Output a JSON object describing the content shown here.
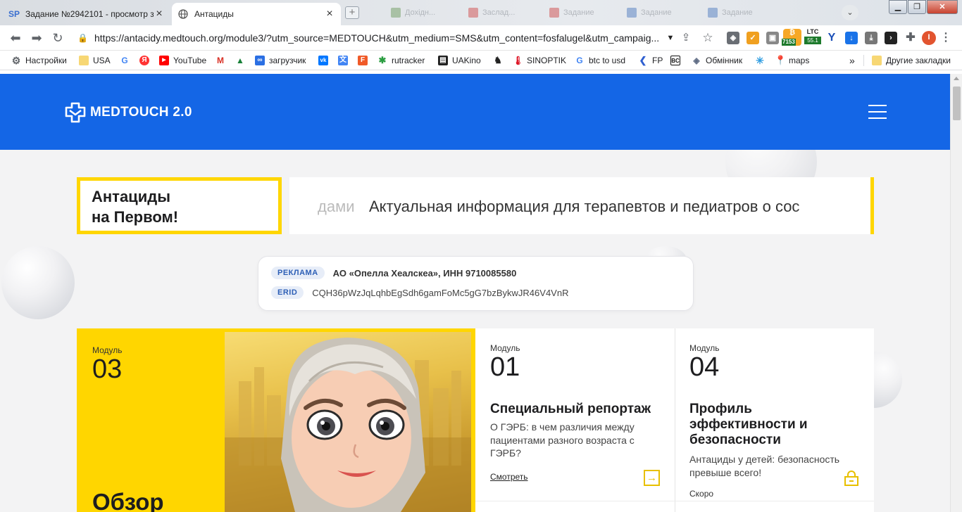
{
  "browser": {
    "tabs": [
      {
        "favicon": "SP",
        "title": "Задание №2942101 - просмотр з",
        "active": false
      },
      {
        "favicon": "globe-icon",
        "title": "Антациды",
        "active": true
      }
    ],
    "url": "https://antacidy.medtouch.org/module3/?utm_source=MEDTOUCH&utm_medium=SMS&utm_content=fosfalugel&utm_campaig...",
    "ext_ltc_label": "LTC",
    "ext_badge_1": "7153",
    "ext_badge_2": "55.1",
    "profile_initial": "I",
    "bookmarks": [
      {
        "label": "Настройки",
        "icon": "gear-icon"
      },
      {
        "label": "USA",
        "icon": "folder-icon"
      },
      {
        "label": "",
        "icon": "google-icon"
      },
      {
        "label": "",
        "icon": "yandex-icon"
      },
      {
        "label": "YouTube",
        "icon": "youtube-icon"
      },
      {
        "label": "",
        "icon": "gmail-icon"
      },
      {
        "label": "",
        "icon": "drive-icon"
      },
      {
        "label": "загрузчик",
        "icon": "infinity-icon"
      },
      {
        "label": "",
        "icon": "vk-icon"
      },
      {
        "label": "",
        "icon": "translate-icon"
      },
      {
        "label": "",
        "icon": "f-icon"
      },
      {
        "label": "rutracker",
        "icon": "rutracker-icon"
      },
      {
        "label": "UAKino",
        "icon": "uakino-icon"
      },
      {
        "label": "",
        "icon": "chess-icon"
      },
      {
        "label": "SINOPTIK",
        "icon": "thermometer-icon"
      },
      {
        "label": "btc to usd",
        "icon": "google-icon"
      },
      {
        "label": "FP",
        "icon": "fp-icon"
      },
      {
        "label": "",
        "icon": "bc-icon"
      },
      {
        "label": "Обмінник",
        "icon": "exchange-icon"
      },
      {
        "label": "",
        "icon": "pinwheel-icon"
      },
      {
        "label": "maps",
        "icon": "maps-icon"
      }
    ],
    "bookmarks_more": "»",
    "other_bookmarks": "Другие закладки"
  },
  "site": {
    "logo_text": "MEDTOUCH 2.0",
    "hero_title_line1": "Антациды",
    "hero_title_line2": "на Первом!",
    "ticker_faded": "дами",
    "ticker_text": "Актуальная информация для терапевтов и педиатров о сос",
    "ad": {
      "label1": "РЕКЛАМА",
      "value1": "АО «Опелла Хеалскеа», ИНН 9710085580",
      "label2": "ERID",
      "value2": "CQH36pWzJqLqhbEgSdh6gamFoMc5gG7bzBykwJR46V4VnR"
    },
    "modules": {
      "featured": {
        "label": "Модуль",
        "number": "03",
        "title": "Обзор"
      },
      "m01": {
        "label": "Модуль",
        "number": "01",
        "title": "Специальный репортаж",
        "desc": "О ГЭРБ: в чем различия между пациентами разного возраста с ГЭРБ?",
        "link": "Смотреть"
      },
      "m04": {
        "label": "Модуль",
        "number": "04",
        "title": "Профиль эффективности и безопасности",
        "desc": "Антациды у детей: безопасность превыше всего!",
        "status": "Скоро"
      }
    }
  },
  "colors": {
    "brand_blue": "#1466e6",
    "accent_yellow": "#ffd600"
  }
}
